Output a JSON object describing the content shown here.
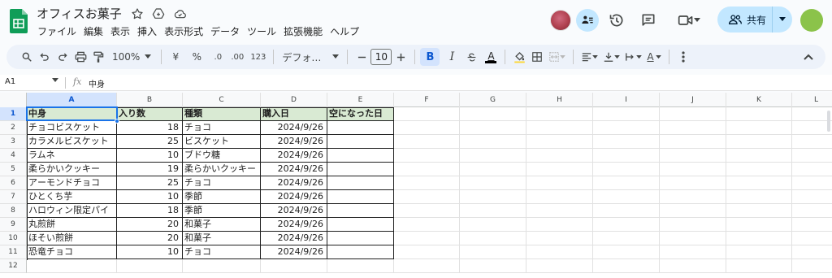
{
  "app": {
    "doc_title": "オフィスお菓子",
    "menu": [
      "ファイル",
      "編集",
      "表示",
      "挿入",
      "表示形式",
      "データ",
      "ツール",
      "拡張機能",
      "ヘルプ"
    ],
    "share_label": "共有",
    "icons": [
      "sheets-logo-icon",
      "star-icon",
      "move-to-drive-icon",
      "cloud-status-icon",
      "history-icon",
      "comment-icon",
      "meet-icon",
      "share-people-icon"
    ],
    "colors": {
      "accent": "#0b57d0",
      "share_bg": "#c2e7ff",
      "header_fill": "#d9ead3",
      "selection": "#1a73e8",
      "logo_green": "#0f9d58"
    }
  },
  "toolbar": {
    "zoom": "100%",
    "currency": "¥",
    "percent": "%",
    "dec_decrease": ".0",
    "dec_increase": ".00",
    "number_format": "123",
    "font_name": "デフォ…",
    "font_size": "10",
    "bold": "B",
    "italic": "I",
    "text_color": "A",
    "text_rotate": "A"
  },
  "formula": {
    "name_box": "A1",
    "fx": "fx",
    "value": "中身"
  },
  "sheet": {
    "columns": [
      "A",
      "B",
      "C",
      "D",
      "E",
      "F",
      "G",
      "H",
      "I",
      "J",
      "K",
      "L"
    ],
    "row_numbers": [
      "1",
      "2",
      "3",
      "4",
      "5",
      "6",
      "7",
      "8",
      "9",
      "10",
      "11",
      "12"
    ],
    "headers": [
      "中身",
      "入り数",
      "種類",
      "購入日",
      "空になった日"
    ],
    "rows": [
      [
        "チョコビスケット",
        "18",
        "チョコ",
        "2024/9/26",
        ""
      ],
      [
        "カラメルビスケット",
        "25",
        "ビスケット",
        "2024/9/26",
        ""
      ],
      [
        "ラムネ",
        "10",
        "ブドウ糖",
        "2024/9/26",
        ""
      ],
      [
        "柔らかいクッキー",
        "19",
        "柔らかいクッキー",
        "2024/9/26",
        ""
      ],
      [
        "アーモンドチョコ",
        "25",
        "チョコ",
        "2024/9/26",
        ""
      ],
      [
        "ひとくち芋",
        "10",
        "季節",
        "2024/9/26",
        ""
      ],
      [
        "ハロウィン限定パイ",
        "18",
        "季節",
        "2024/9/26",
        ""
      ],
      [
        "丸煎餅",
        "20",
        "和菓子",
        "2024/9/26",
        ""
      ],
      [
        "ほそい煎餅",
        "20",
        "和菓子",
        "2024/9/26",
        ""
      ],
      [
        "恐竜チョコ",
        "10",
        "チョコ",
        "2024/9/26",
        ""
      ]
    ]
  }
}
